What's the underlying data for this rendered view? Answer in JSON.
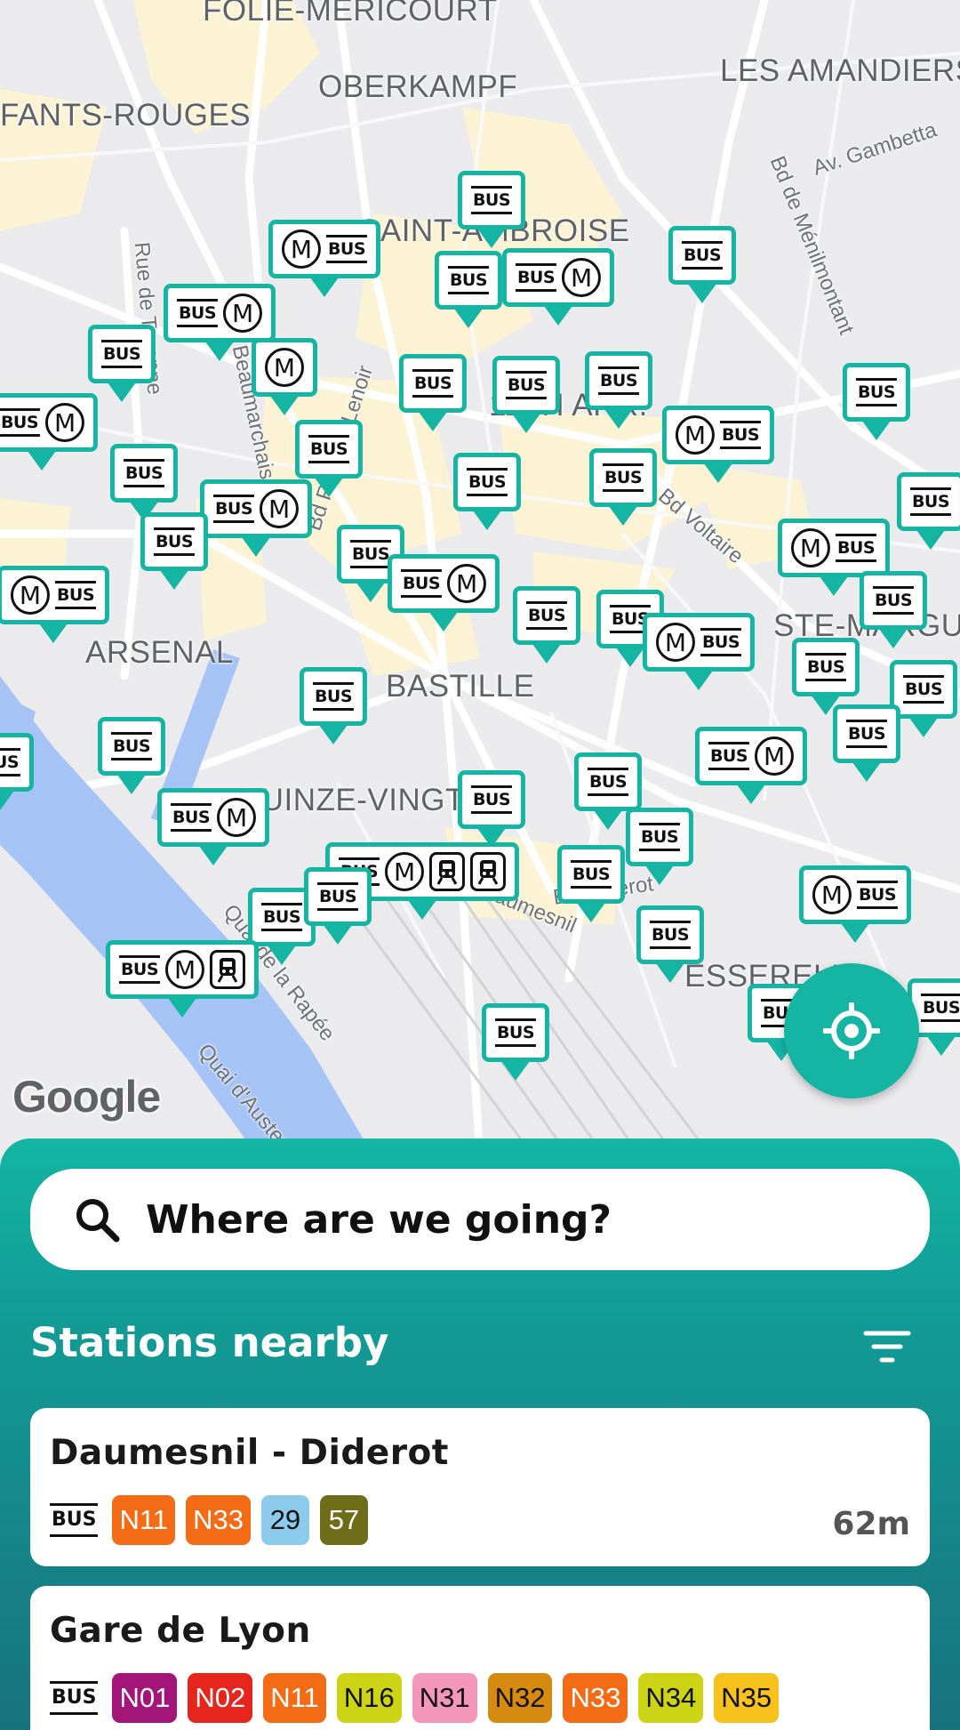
{
  "map": {
    "place_labels": [
      "FOLIE-MÉRICOURT",
      "OBERKAMPF",
      "LES AMANDIERS",
      "FANTS-ROUGES",
      "SAINT-AMBROISE",
      "11TH ARR.",
      "ARSENAL",
      "BASTILLE",
      "QUINZE-VINGTS",
      "STE-MARGUE",
      "ESSERELL"
    ],
    "street_labels": [
      "Av. Gambetta",
      "Bd de Ménilmontant",
      "Rue de Turenne",
      "Bd Beaumarchais",
      "Bd Richard-Lenoir",
      "Bd Voltaire",
      "Bd Diderot",
      "Quai de la Rapée",
      "Quai d'Austerlitz",
      "Av. Daumesnil"
    ],
    "attribution": "Google",
    "marker_bus_label": "BUS",
    "marker_metro_label": "M"
  },
  "bottom_sheet": {
    "search": {
      "placeholder": "Where are we going?",
      "icon": "search-icon"
    },
    "section_title": "Stations nearby",
    "filter_icon": "filter-icon",
    "stations": [
      {
        "name": "Daumesnil - Diderot",
        "mode": "BUS",
        "distance": "62m",
        "lines": [
          {
            "label": "N11",
            "bg": "#f36b14",
            "fg": "#ffffff"
          },
          {
            "label": "N33",
            "bg": "#f36b14",
            "fg": "#ffffff"
          },
          {
            "label": "29",
            "bg": "#8ccbeb",
            "fg": "#111111"
          },
          {
            "label": "57",
            "bg": "#6e6e1a",
            "fg": "#ffffff"
          }
        ]
      },
      {
        "name": "Gare de Lyon",
        "mode": "BUS",
        "distance": "",
        "lines": [
          {
            "label": "N01",
            "bg": "#a4157a",
            "fg": "#ffffff"
          },
          {
            "label": "N02",
            "bg": "#e6261c",
            "fg": "#ffffff"
          },
          {
            "label": "N11",
            "bg": "#f36b14",
            "fg": "#ffffff"
          },
          {
            "label": "N16",
            "bg": "#cdd416",
            "fg": "#111111"
          },
          {
            "label": "N31",
            "bg": "#f596bb",
            "fg": "#111111"
          },
          {
            "label": "N32",
            "bg": "#d68a10",
            "fg": "#111111"
          },
          {
            "label": "N33",
            "bg": "#f36b14",
            "fg": "#ffffff"
          },
          {
            "label": "N34",
            "bg": "#cdd416",
            "fg": "#111111"
          },
          {
            "label": "N35",
            "bg": "#f7c21b",
            "fg": "#111111"
          }
        ]
      }
    ]
  },
  "colors": {
    "accent": "#15b5a4",
    "river": "#a6c3f5",
    "sheet_dark": "#18727d"
  }
}
